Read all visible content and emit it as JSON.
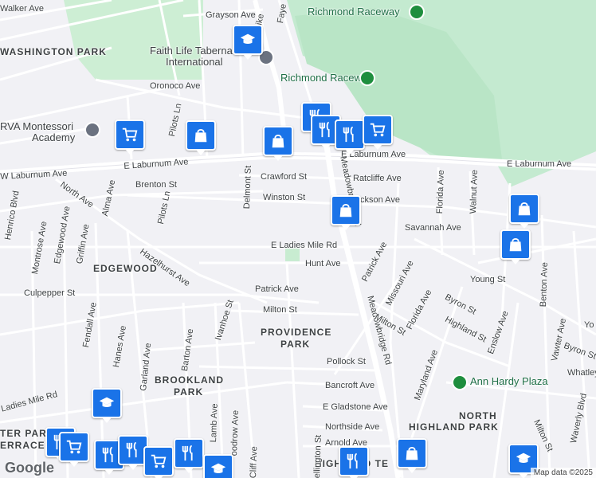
{
  "areas": {
    "washington_park": "WASHINGTON PARK",
    "edgewood": "EDGEWOOD",
    "providence": "PROVIDENCE",
    "park": "PARK",
    "brookland": "BROOKLAND",
    "brookland_park": "PARK",
    "north": "NORTH",
    "highland_park": "HIGHLAND PARK",
    "terrace_left": "TER PARK",
    "terrace_left2": "ERRACE",
    "highland_terrace": "HIGHLAND TE"
  },
  "pois": {
    "raceway_top": "Richmond Raceway",
    "raceway_mid": "Richmond Raceway",
    "faith_life": "Faith Life Tabernacle",
    "faith_life2": "International",
    "montessori": "RVA Montessori",
    "montessori2": "Academy",
    "ann_hardy": "Ann Hardy Plaza"
  },
  "streets": {
    "walker": "Walker Ave",
    "grayson": "Grayson Ave",
    "turnpike": "pike",
    "fayette": "Faye",
    "oronoco": "Oronoco Ave",
    "pilots_ln": "Pilots Ln",
    "pilots_ln2": "Pilots Ln",
    "w_laburnum": "W Laburnum Ave",
    "e_laburnum_w": "E Laburnum Ave",
    "e_laburnum_c": "E Laburnum Ave",
    "e_laburnum_e": "E Laburnum Ave",
    "crawford": "Crawford St",
    "ratcliffe": "Ratcliffe Ave",
    "brenton": "Brenton St",
    "winston": "Winston St",
    "jackson": "ckson Ave",
    "north_ave": "North Ave",
    "alma": "Alma Ave",
    "henrico": "Henrico Blvd",
    "montrose": "Montrose Ave",
    "edgewood_ave": "Edgewood Ave",
    "griffin": "Griffin Ave",
    "delmont": "Delmont St",
    "meadowbridge_top": "Meadowbridge Rd",
    "meadowbridge_bot": "Meadowbridge Rd",
    "florida_top": "Florida Ave",
    "walnut": "Walnut Ave",
    "savannah": "Savannah Ave",
    "hazelhurst": "Hazelhurst Ave",
    "ladies_mile": "E Ladies Mile Rd",
    "ladies_mile_w": "Ladies Mile Rd",
    "hunt": "Hunt Ave",
    "patrick_e": "Patrick Ave",
    "patrick": "Patrick Ave",
    "culpepper": "Culpepper St",
    "fendall": "Fendall Ave",
    "ivanhoe": "Ivanhoe St",
    "milton": "Milton St",
    "milton_e": "Milton St",
    "missouri": "Missouri Ave",
    "florida_mid": "Florida Ave",
    "byron": "Byron St",
    "young": "Young St",
    "benton": "Benton Ave",
    "highland_st": "Highland St",
    "enslow": "Enslow Ave",
    "byron_e": "Byron St",
    "whatley": "Whatley",
    "yo": "Yo",
    "vawter": "Vawter Ave",
    "waverly": "Waverly Blvd",
    "barton": "Barton Ave",
    "hanes": "Hanes Ave",
    "garland": "Garland Ave",
    "pollock": "Pollock St",
    "maryland": "Maryland Ave",
    "bancroft": "Bancroft Ave",
    "e_gladstone": "E Gladstone Ave",
    "northside": "Northside Ave",
    "arnold": "Arnold Ave",
    "lamb": "Lamb Ave",
    "woodrow": "oodrow Ave",
    "cliff": "Cliff Ave",
    "wellington": "ellington St",
    "milton_sw": "Milton St",
    "ladies_w": "Ladies Mile Rd"
  },
  "attribution": "Map data ©2025",
  "google_logo": "Google",
  "colors": {
    "park_green": "#c8ecd1",
    "pin_blue": "#1a73e8",
    "road_major": "#ffffff",
    "land": "#f2f2f6"
  }
}
